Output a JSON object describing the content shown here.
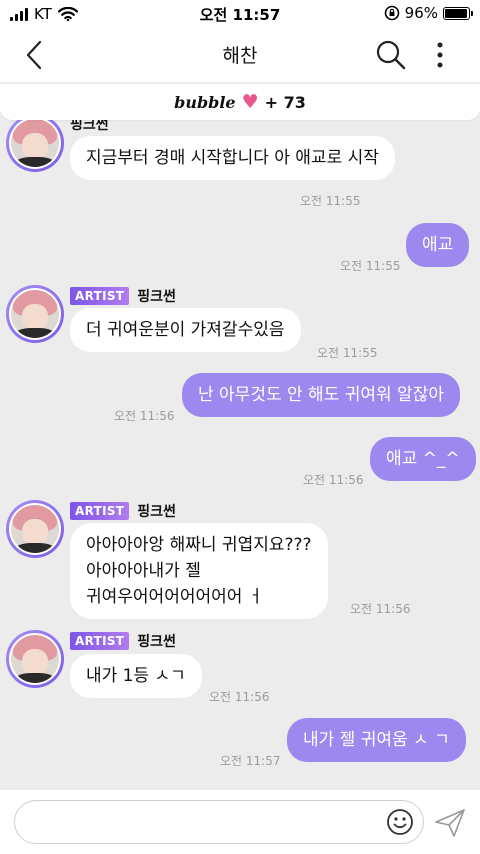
{
  "status_bar": {
    "carrier": "KT",
    "time": "오전 11:57",
    "battery": "96%",
    "battery_level": 0.96
  },
  "header": {
    "title": "해찬"
  },
  "bubble_bar": {
    "logo": "bubble",
    "count": "+ 73"
  },
  "colors": {
    "outgoing_bubble": "#9d88ef",
    "incoming_bubble": "#ffffff",
    "chat_background": "#ececec",
    "artist_badge": "#7d55e6"
  },
  "messages": [
    {
      "direction": "incoming",
      "badge": "",
      "sender": "핑크썬",
      "text": "지금부터 경매 시작합니다\n아 애교로 시작",
      "time": "오전 11:55"
    },
    {
      "direction": "outgoing",
      "text": "애교",
      "time": "오전 11:55"
    },
    {
      "direction": "incoming",
      "badge": "ARTIST",
      "sender": "핑크썬",
      "text": "더 귀여운분이 가져갈수있음",
      "time": "오전 11:55"
    },
    {
      "direction": "outgoing",
      "text": "난 아무것도 안 해도 귀여워 알잖아",
      "time": "오전 11:56"
    },
    {
      "direction": "outgoing",
      "text": "애교 ^_^",
      "time": "오전 11:56"
    },
    {
      "direction": "incoming",
      "badge": "ARTIST",
      "sender": "핑크썬",
      "text": "아아아아앙 해짜니 귀엽지요???\n아아아아내가 젤\n귀여우어어어어어어어 ㅓ",
      "time": "오전 11:56"
    },
    {
      "direction": "incoming",
      "badge": "ARTIST",
      "sender": "핑크썬",
      "text": "내가 1등 ㅅㄱ",
      "time": "오전 11:56"
    },
    {
      "direction": "outgoing",
      "text": "내가 젤 귀여움 ㅅ ㄱ",
      "time": "오전 11:57"
    }
  ],
  "input": {
    "placeholder": ""
  },
  "icons": {
    "back": "chevron-left-icon",
    "search": "search-icon",
    "more": "more-vertical-icon",
    "emoji": "smiley-icon",
    "send": "paper-plane-icon"
  }
}
